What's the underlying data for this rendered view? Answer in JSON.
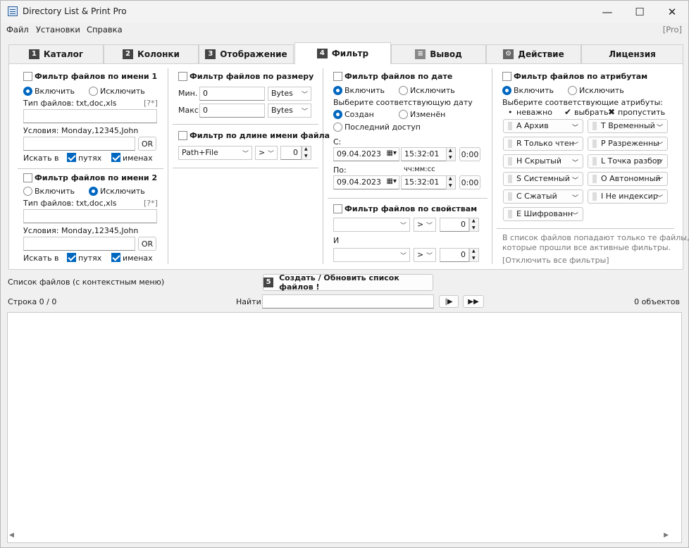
{
  "window": {
    "title": "Directory List & Print Pro",
    "minimize": "—",
    "maximize": "☐",
    "close": "✕"
  },
  "menu": {
    "file": "Файл",
    "settings": "Установки",
    "help": "Справка",
    "pro": "[Pro]"
  },
  "tabs": [
    {
      "num": "1",
      "label": "Каталог"
    },
    {
      "num": "2",
      "label": "Колонки"
    },
    {
      "num": "3",
      "label": "Отображение"
    },
    {
      "num": "4",
      "label": "Фильтр"
    },
    {
      "num": "",
      "label": "Вывод"
    },
    {
      "num": "",
      "label": "Действие"
    },
    {
      "num": "",
      "label": "Лицензия"
    }
  ],
  "name1": {
    "title": "Фильтр файлов по имени 1",
    "include": "Включить",
    "exclude": "Исключить",
    "types_label": "Тип файлов: txt,doc,xls",
    "help": "[?*]",
    "cond_label": "Условия: Monday,12345,John",
    "or": "OR",
    "search_in": "Искать в",
    "paths": "путях",
    "names": "именах"
  },
  "name2": {
    "title": "Фильтр файлов по имени 2",
    "include": "Включить",
    "exclude": "Исключить",
    "types_label": "Тип файлов: txt,doc,xls",
    "help": "[?*]",
    "cond_label": "Условия: Monday,12345,John",
    "or": "OR",
    "search_in": "Искать в",
    "paths": "путях",
    "names": "именах"
  },
  "size": {
    "title": "Фильтр файлов по размеру",
    "min_label": "Мин.",
    "min_value": "0",
    "max_label": "Макс",
    "max_value": "0",
    "unit_min": "Bytes",
    "unit_max": "Bytes"
  },
  "namelen": {
    "title": "Фильтр по длине имени файла",
    "mode": "Path+File",
    "op": ">",
    "value": "0"
  },
  "date": {
    "title": "Фильтр файлов по дате",
    "include": "Включить",
    "exclude": "Исключить",
    "choose": "Выберите соответствующую дату",
    "created": "Создан",
    "modified": "Изменён",
    "accessed": "Последний доступ",
    "from": "С:",
    "from_date": "09.04.2023",
    "from_time": "15:32:01",
    "from_offset": "0:00",
    "to": "По:",
    "time_hint": "чч:мм:сс",
    "to_date": "09.04.2023",
    "to_time": "15:32:01",
    "to_offset": "0:00"
  },
  "props": {
    "title": "Фильтр файлов по свойствам",
    "op1": ">",
    "val1": "0",
    "and": "И",
    "op2": ">",
    "val2": "0"
  },
  "attrs": {
    "title": "Фильтр файлов по атрибутам",
    "include": "Включить",
    "exclude": "Исключить",
    "choose": "Выберите соответствующие атрибуты:",
    "legend_dont_care": "неважно",
    "legend_select": "выбрать",
    "legend_skip": "пропустить",
    "items": [
      "A Архив",
      "T Временный",
      "R Только чтен",
      "P Разреженны",
      "H Скрытый",
      "L Точка разбор",
      "S Системный",
      "O Автономный",
      "C Сжатый",
      "I Не индексир",
      "E Шифрованн"
    ],
    "note1": "В список файлов попадают только те файлы,",
    "note2": "которые прошли все активные фильтры.",
    "disable_all": "[Отключить все фильтры]"
  },
  "bottom": {
    "list_label": "Список файлов (с контекстным меню)",
    "create_num": "5",
    "create_btn": "Создать / Обновить список файлов !",
    "row": "Строка 0 / 0",
    "find": "Найти",
    "next": "|▶",
    "ffwd": "▶▶",
    "count": "0 объектов"
  }
}
